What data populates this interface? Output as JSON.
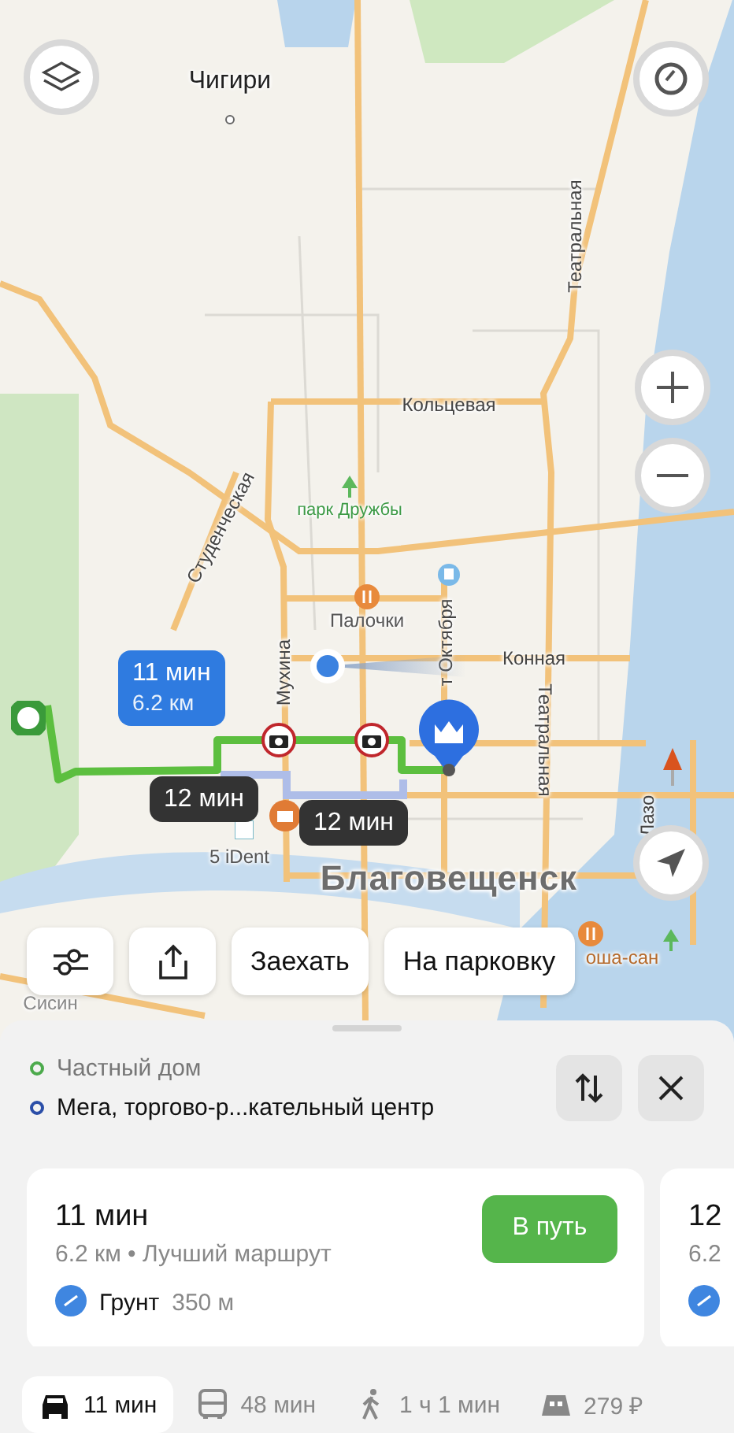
{
  "map": {
    "labels": [
      {
        "text": "Чигири",
        "kind": "settlement"
      },
      {
        "text": "Кольцевая",
        "kind": "street"
      },
      {
        "text": "Театральная",
        "kind": "street"
      },
      {
        "text": "Студенческая",
        "kind": "street"
      },
      {
        "text": "парк Дружбы",
        "kind": "park"
      },
      {
        "text": "Палочки",
        "kind": "poi"
      },
      {
        "text": "Мухина",
        "kind": "street"
      },
      {
        "text": "т Октября",
        "kind": "street"
      },
      {
        "text": "Конная",
        "kind": "street"
      },
      {
        "text": "Театральная",
        "kind": "street"
      },
      {
        "text": "Лазо",
        "kind": "street"
      },
      {
        "text": "5 iDent",
        "kind": "poi"
      },
      {
        "text": "Благовещенск",
        "kind": "city"
      },
      {
        "text": "оша-сан",
        "kind": "food"
      },
      {
        "text": "Сисин",
        "kind": "district"
      }
    ],
    "callouts": [
      {
        "time": "11 мин",
        "distance": "6.2 км",
        "selected": true
      },
      {
        "time": "12 мин",
        "selected": false
      },
      {
        "time": "12 мин",
        "selected": false
      }
    ]
  },
  "actions": [
    {
      "kind": "settings"
    },
    {
      "kind": "share"
    },
    {
      "kind": "text",
      "label": "Заехать"
    },
    {
      "kind": "text",
      "label": "На парковку"
    }
  ],
  "route": {
    "from": "Частный дом",
    "to": "Мега, торгово-р...кательный центр"
  },
  "cards": [
    {
      "time": "11 мин",
      "details": "6.2 км • Лучший маршрут",
      "surface": "Грунт",
      "surface_length": "350 м",
      "button": "В путь"
    },
    {
      "time": "12",
      "details": "6.2"
    }
  ],
  "modes": [
    {
      "kind": "car",
      "label": "11 мин",
      "selected": true
    },
    {
      "kind": "bus",
      "label": "48 мин",
      "selected": false
    },
    {
      "kind": "walk",
      "label": "1 ч 1 мин",
      "selected": false
    },
    {
      "kind": "taxi",
      "label": "279 ₽",
      "selected": false
    }
  ]
}
